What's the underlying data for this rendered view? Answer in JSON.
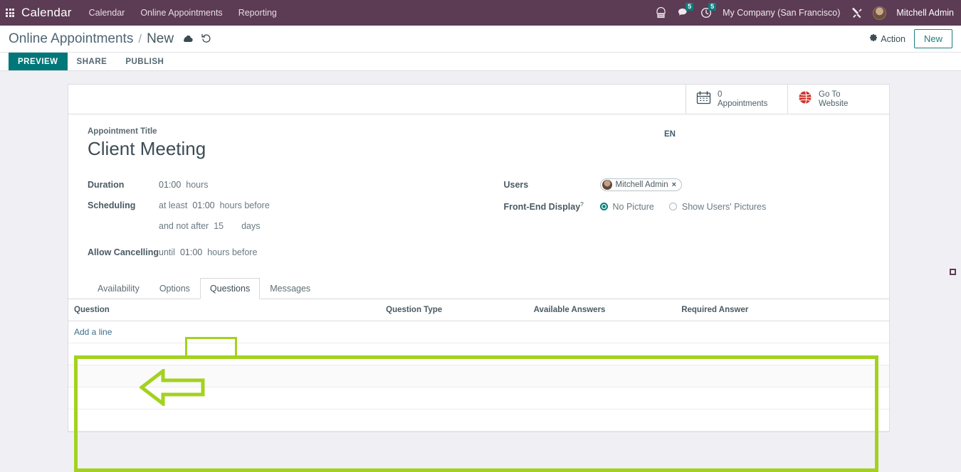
{
  "navbar": {
    "apps_icon": "apps-grid-icon",
    "brand": "Calendar",
    "menu": [
      {
        "label": "Calendar"
      },
      {
        "label": "Online Appointments"
      },
      {
        "label": "Reporting"
      }
    ],
    "icons": {
      "voip": "phone-icon",
      "messages": "chat-bubble-icon",
      "activities": "clock-icon",
      "debug": "tools-icon"
    },
    "messages_badge": "5",
    "activities_badge": "5",
    "company": "My Company (San Francisco)",
    "user": "Mitchell Admin",
    "avatar": "user-avatar",
    "bg_color": "#5c3b54",
    "badge_color": "#0e7c7b"
  },
  "control_panel": {
    "breadcrumb_root": "Online Appointments",
    "breadcrumb_separator": "/",
    "breadcrumb_leaf": "New",
    "save_icon": "cloud-save-icon",
    "discard_icon": "undo-discard-icon",
    "action_label": "Action",
    "action_icon": "gear-icon",
    "new_label": "New"
  },
  "website_bar": {
    "items": [
      {
        "label": "PREVIEW",
        "active": true
      },
      {
        "label": "SHARE",
        "active": false
      },
      {
        "label": "PUBLISH",
        "active": false
      }
    ],
    "active_color": "#00787a"
  },
  "stat_buttons": [
    {
      "icon": "calendar-icon",
      "value": "0",
      "label": "Appointments"
    },
    {
      "icon": "globe-icon",
      "line1": "Go To",
      "line2": "Website",
      "icon_color": "#d0342c"
    }
  ],
  "form": {
    "title_label": "Appointment Title",
    "title_value": "Client Meeting",
    "language_badge": "EN",
    "left_fields": {
      "duration_label": "Duration",
      "duration_value": "01:00",
      "duration_unit": "hours",
      "scheduling_label": "Scheduling",
      "scheduling_prefix": "at least",
      "scheduling_value": "01:00",
      "scheduling_suffix": "hours before",
      "notafter_prefix": "and not after",
      "notafter_value": "15",
      "notafter_suffix": "days",
      "cancel_label": "Allow Cancelling",
      "cancel_prefix": "until",
      "cancel_value": "01:00",
      "cancel_suffix": "hours before"
    },
    "right_fields": {
      "users_label": "Users",
      "users_tag": "Mitchell Admin",
      "users_tag_remove": "×",
      "frontend_label": "Front-End Display",
      "frontend_help": "?",
      "radio_no_picture": "No Picture",
      "radio_show_pictures": "Show Users' Pictures",
      "selected": "No Picture"
    }
  },
  "notebook": {
    "tabs": [
      {
        "label": "Availability",
        "active": false
      },
      {
        "label": "Options",
        "active": false
      },
      {
        "label": "Questions",
        "active": true
      },
      {
        "label": "Messages",
        "active": false
      }
    ],
    "questions_table": {
      "columns": [
        "Question",
        "Question Type",
        "Available Answers",
        "Required Answer"
      ],
      "rows": [],
      "add_line_label": "Add a line",
      "empty_row_count": 4
    }
  },
  "annotations": {
    "color": "#a3d21e",
    "tab_highlight_target": "Questions",
    "box_highlight_target": "questions-table",
    "arrow_direction": "left",
    "arrow_points_at": "Add a line"
  }
}
